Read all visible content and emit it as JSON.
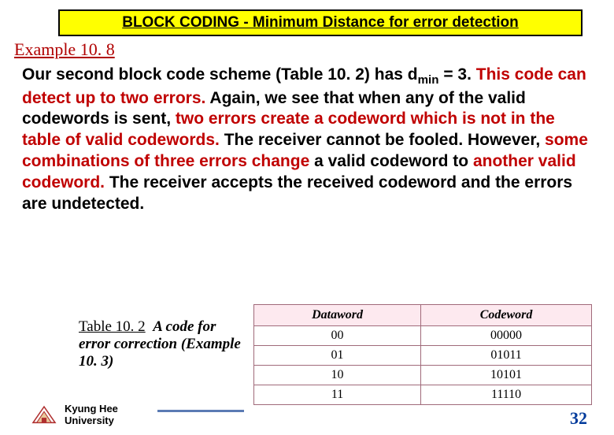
{
  "header": {
    "title": "BLOCK CODING - Minimum Distance for error detection"
  },
  "example_label": "Example 10. 8",
  "body": {
    "s1a": "Our second block code scheme (Table 10. 2) has d",
    "s1sub": "min",
    "s1b": " = 3. ",
    "s2": "This code can detect up to two errors.",
    "s3a": " Again, we see that when any of the valid codewords is sent, ",
    "s3b": "two errors create a codeword which is not in the table of valid codewords.",
    "s4a": " The receiver cannot be fooled. However, ",
    "s4b": "some combinations of three errors change",
    "s4c": " a valid codeword to ",
    "s4d": "another valid codeword.",
    "s5": " The receiver accepts the received codeword and the errors are undetected."
  },
  "table_caption": {
    "num": "Table 10. 2",
    "title": "A code for error correction (Example 10. 3)"
  },
  "table": {
    "headers": [
      "Dataword",
      "Codeword"
    ],
    "rows": [
      [
        "00",
        "00000"
      ],
      [
        "01",
        "01011"
      ],
      [
        "10",
        "10101"
      ],
      [
        "11",
        "11110"
      ]
    ]
  },
  "footer": {
    "line1": "Kyung Hee",
    "line2": "University"
  },
  "page_number": "32"
}
